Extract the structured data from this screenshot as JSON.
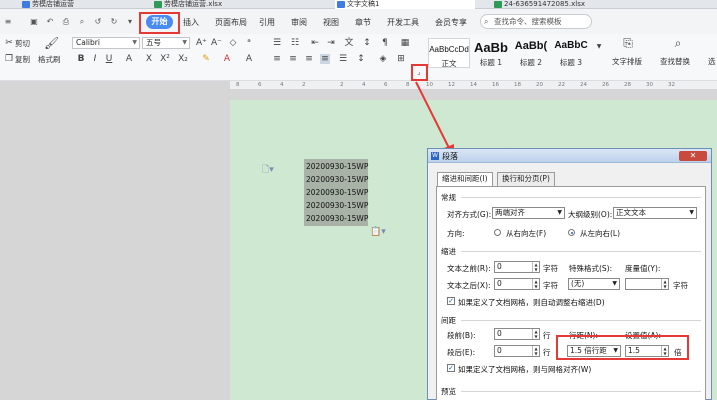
{
  "tabs": [
    {
      "label": "劳模店铺运营",
      "color": "#3f7be0"
    },
    {
      "label": "劳模店铺运营.xlsx",
      "color": "#2e9a55"
    },
    {
      "label": "文字文稿1",
      "color": "#3f7be0"
    },
    {
      "label": "24-636591472085.xlsx",
      "color": "#2e9a55"
    }
  ],
  "menu": {
    "start": "开始",
    "items": [
      "插入",
      "页面布局",
      "引用",
      "审阅",
      "视图",
      "章节",
      "开发工具",
      "会员专享"
    ],
    "search_placeholder": "查找命令、搜索模板"
  },
  "ribbon": {
    "cut": "剪切",
    "copy": "复制",
    "format_painter": "格式刷",
    "font_name": "Calibri",
    "font_size": "五号",
    "styles": [
      {
        "sample": "AaBbCcDd",
        "name": "正文"
      },
      {
        "sample": "AaBb",
        "name": "标题 1"
      },
      {
        "sample": "AaBb(",
        "name": "标题 2"
      },
      {
        "sample": "AaBbC",
        "name": "标题 3"
      }
    ],
    "text_layout": "文字排版",
    "find_replace": "查找替换",
    "select": "选"
  },
  "ruler": {
    "ticks": [
      "8",
      "6",
      "4",
      "2",
      "2",
      "4",
      "6",
      "8",
      "10",
      "12",
      "14",
      "16",
      "18",
      "20",
      "22",
      "24",
      "26",
      "28",
      "30",
      "32"
    ]
  },
  "document": {
    "lines": [
      "20200930-15WP",
      "20200930-15WP",
      "20200930-15WP",
      "20200930-15WP",
      "20200930-15WP"
    ]
  },
  "dialog": {
    "title": "段落",
    "close": "✕",
    "tab_indent": "缩进和间距(I)",
    "tab_linebreak": "换行和分页(P)",
    "general": "常规",
    "alignment_label": "对齐方式(G):",
    "alignment_value": "两端对齐",
    "outline_label": "大纲级别(O):",
    "outline_value": "正文文本",
    "direction_label": "方向:",
    "rtl": "从右向左(F)",
    "ltr": "从左向右(L)",
    "indent": "缩进",
    "before_text_label": "文本之前(R):",
    "before_text_value": "0",
    "after_text_label": "文本之后(X):",
    "after_text_value": "0",
    "unit_char": "字符",
    "special_label": "特殊格式(S):",
    "special_value": "(无)",
    "degree_label": "度量值(Y):",
    "indent_grid_check": "如果定义了文档网格，则自动调整右缩进(D)",
    "spacing": "间距",
    "before_label": "段前(B):",
    "before_value": "0",
    "after_label": "段后(E):",
    "after_value": "0",
    "unit_line": "行",
    "line_spacing_label": "行距(N):",
    "line_spacing_value": "1.5 倍行距",
    "setting_label": "设置值(A):",
    "setting_value": "1.5",
    "unit_times": "倍",
    "spacing_grid_check": "如果定义了文档网格，则与网格对齐(W)",
    "preview": "预览"
  }
}
